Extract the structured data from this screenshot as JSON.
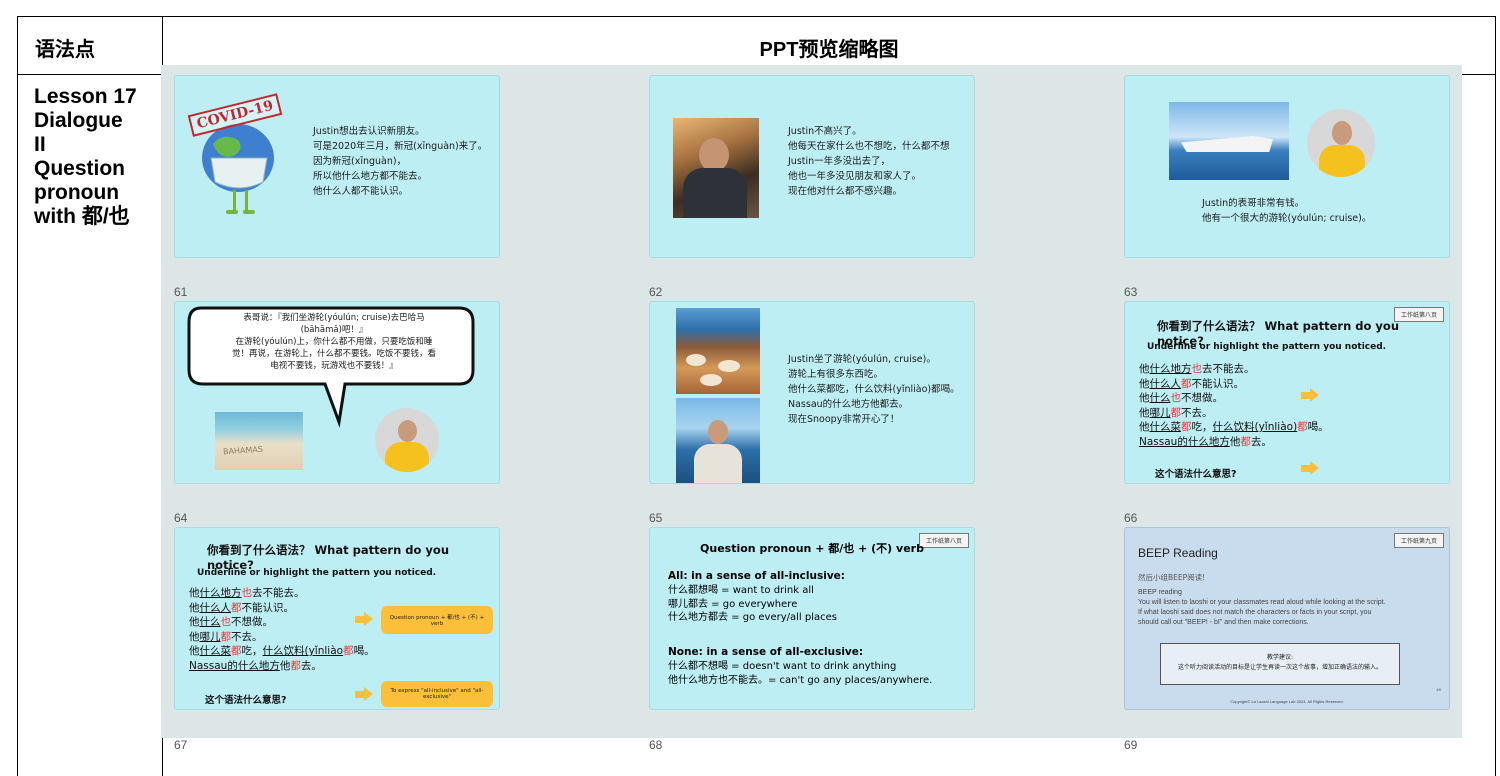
{
  "header": {
    "left": "语法点",
    "right": "PPT预览缩略图"
  },
  "lesson": {
    "label": "Lesson 17\nDialogue\nII\nQuestion\npronoun\nwith 都/也"
  },
  "slides": {
    "s61": {
      "num": "61",
      "stamp": "COVID-19",
      "text": "Justin想出去认识新朋友。\n可是2020年三月，新冠(xīnguàn)来了。\n因为新冠(xīnguàn)，\n所以他什么地方都不能去。\n他什么人都不能认识。"
    },
    "s62": {
      "num": "62",
      "text": "Justin不高兴了。\n他每天在家什么也不想吃，什么都不想\nJustin一年多没出去了，\n他也一年多没见朋友和家人了。\n现在他对什么都不感兴趣。"
    },
    "s63": {
      "num": "63",
      "text": "Justin的表哥非常有钱。\n他有一个很大的游轮(yóulún; cruise)。"
    },
    "s64": {
      "num": "64",
      "bubble": "表哥说：『我们坐游轮(yóulún; cruise)去巴哈马\n(bāhāmǎ)吧！』\n在游轮(yóulún)上，你什么都不用做，只要吃饭和睡\n觉！再说，在游轮上，什么都不要钱。吃饭不要钱，看\n电视不要钱，玩游戏也不要钱！』",
      "beach_text": "BAHAMAS"
    },
    "s65": {
      "num": "65",
      "text": "Justin坐了游轮(yóulún, cruise)。\n游轮上有很多东西吃。\n他什么菜都吃，什么饮料(yǐnliào)都喝。\nNassau的什么地方他都去。\n现在Snoopy非常开心了！"
    },
    "s66": {
      "num": "66",
      "tag": "工作纸第八页",
      "title": "你看到了什么语法？ What pattern do you notice?",
      "sub": "Underline or highlight the pattern you noticed.",
      "lines": [
        {
          "a": "他",
          "u1": "什么地方",
          "r": "也",
          "b": "去不能去。"
        },
        {
          "a": "他",
          "u1": "什么人",
          "r": "都",
          "b": "不能认识。"
        },
        {
          "a": "他",
          "u1": "什么",
          "r": "也",
          "b": "不想做。"
        },
        {
          "a": "他",
          "u1": "哪儿",
          "r": "都",
          "b": "不去。"
        },
        {
          "a": "他",
          "u1": "什么菜",
          "r": "都",
          "b": "吃，",
          "u2": "什么饮料(yǐnliào)",
          "r2": "都",
          "c": "喝。"
        },
        {
          "a": "",
          "u1": "Nassau的什么地方",
          "r": "",
          "b": "他",
          "r2b": "都",
          "c": "去。"
        }
      ],
      "meaning": "这个语法什么意思?"
    },
    "s67": {
      "num": "67",
      "title": "你看到了什么语法？ What pattern do you notice?",
      "sub": "Underline or highlight the pattern you noticed.",
      "meaning": "这个语法什么意思?",
      "box1": "Question pronoun + 都/也 + (不) + verb",
      "box2": "To express \"all-inclusive\" and \"all-exclusive\""
    },
    "s68": {
      "num": "68",
      "tag": "工作纸第八页",
      "title": "Question pronoun + 都/也 + (不) verb",
      "h1": "All: in a sense of all-inclusive:",
      "l1": "什么都想喝 = want to drink all\n哪儿都去 = go everywhere\n什么地方都去 = go every/all places",
      "h2": "None: in a sense of all-exclusive:",
      "l2": "什么都不想喝 = doesn't want to drink anything\n他什么地方也不能去。= can't go any places/anywhere."
    },
    "s69": {
      "num": "69",
      "tag": "工作纸第九页",
      "title": "BEEP Reading",
      "sub": "然后小组BEEP阅读!",
      "body": "BEEP reading\nYou will listen to laoshi or your classmates read aloud while looking at the script.\nIf what laoshi said does not match the characters or facts in your script, you\nshould call out \"BEEP! - bī\" and then make corrections.",
      "box_title": "教学建议:",
      "box_text": "这个听力阅读活动的目标是让学生再读一次这个故事，增加正确语法的输入。",
      "copyright": "Copyright© La Laoshi Language Lab 2024. All Rights Reserved.",
      "page": "69"
    }
  }
}
